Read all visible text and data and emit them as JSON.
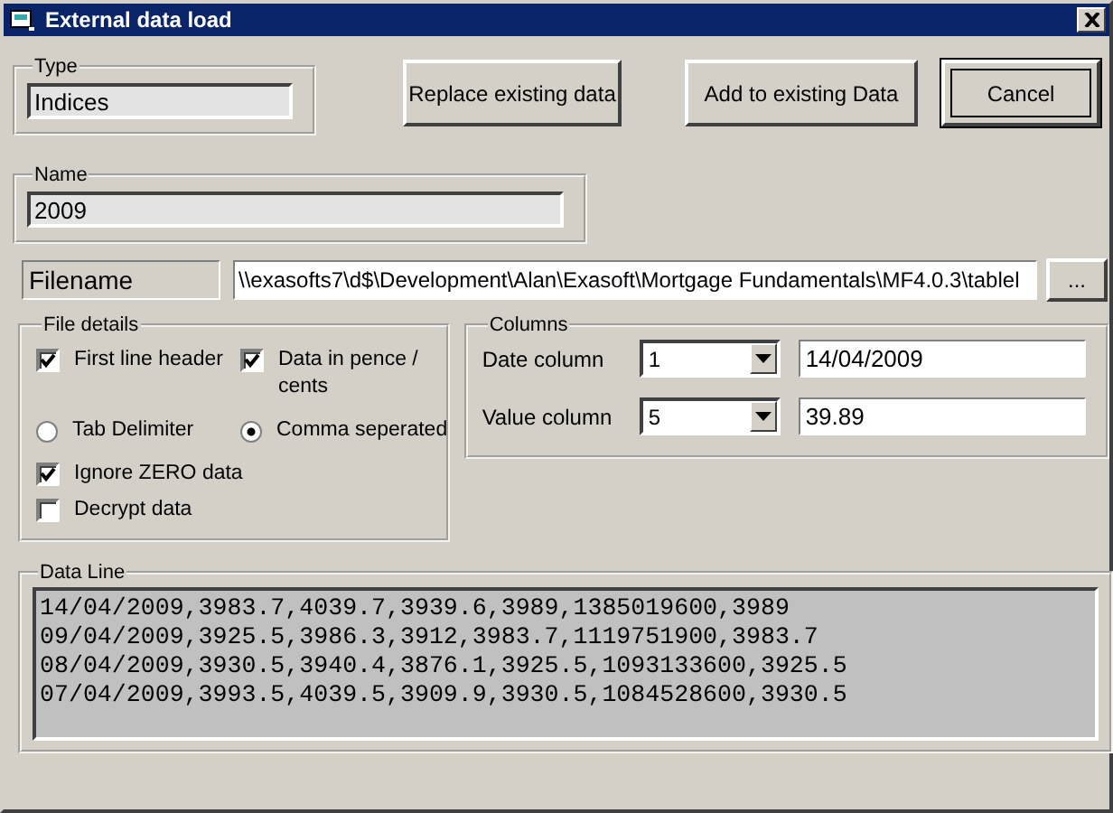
{
  "window": {
    "title": "External data load"
  },
  "type_group": {
    "label": "Type",
    "value": "Indices"
  },
  "buttons": [
    {
      "label": "Replace existing data",
      "default": false
    },
    {
      "label": "Add to existing Data",
      "default": false
    },
    {
      "label": "Cancel",
      "default": true
    }
  ],
  "name_group": {
    "label": "Name",
    "value": "2009"
  },
  "filename": {
    "label": "Filename",
    "value": "\\\\exasofts7\\d$\\Development\\Alan\\Exasoft\\Mortgage Fundamentals\\MF4.0.3\\tablel",
    "browse": "..."
  },
  "file_details": {
    "label": "File details",
    "options": [
      {
        "kind": "checkbox",
        "label": "First line header",
        "checked": true
      },
      {
        "kind": "checkbox",
        "label": "Data in pence / cents",
        "checked": true
      },
      {
        "kind": "radio",
        "label": "Tab Delimiter",
        "selected": false
      },
      {
        "kind": "radio",
        "label": "Comma seperated",
        "selected": true
      },
      {
        "kind": "checkbox",
        "label": "Ignore ZERO data",
        "checked": true
      },
      {
        "kind": "checkbox",
        "label": "Decrypt data",
        "checked": false
      }
    ]
  },
  "columns": {
    "label": "Columns",
    "rows": [
      {
        "label": "Date column",
        "choice": "1",
        "value": "14/04/2009"
      },
      {
        "label": "Value column",
        "choice": "5",
        "value": "39.89"
      }
    ]
  },
  "data_line": {
    "label": "Data Line",
    "lines": [
      "14/04/2009,3983.7,4039.7,3939.6,3989,1385019600,3989",
      "09/04/2009,3925.5,3986.3,3912,3983.7,1119751900,3983.7",
      "08/04/2009,3930.5,3940.4,3876.1,3925.5,1093133600,3925.5",
      "07/04/2009,3993.5,4039.5,3909.9,3930.5,1084528600,3930.5"
    ]
  }
}
